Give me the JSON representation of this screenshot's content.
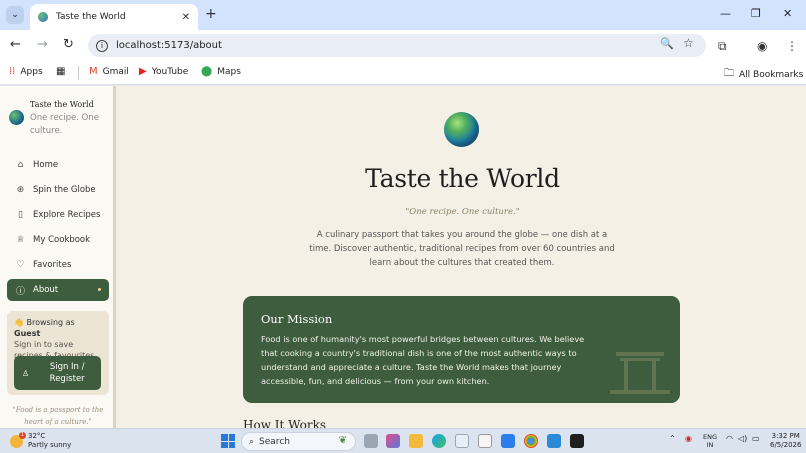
{
  "browser": {
    "tab_title": "Taste the World",
    "url": "localhost:5173/about",
    "bookmarks": [
      {
        "label": "Apps",
        "icon": "apps-grid-icon"
      },
      {
        "label": "Gmail",
        "icon": "gmail-icon"
      },
      {
        "label": "YouTube",
        "icon": "youtube-icon"
      },
      {
        "label": "Maps",
        "icon": "maps-icon"
      }
    ],
    "all_bookmarks": "All Bookmarks"
  },
  "sidebar": {
    "brand_title": "Taste the World",
    "brand_tagline": "One recipe. One culture.",
    "nav": [
      {
        "label": "Home",
        "icon": "home-icon",
        "active": false
      },
      {
        "label": "Spin the Globe",
        "icon": "globe-icon",
        "active": false
      },
      {
        "label": "Explore Recipes",
        "icon": "book-icon",
        "active": false
      },
      {
        "label": "My Cookbook",
        "icon": "chef-hat-icon",
        "active": false
      },
      {
        "label": "Favorites",
        "icon": "heart-icon",
        "active": false
      },
      {
        "label": "About",
        "icon": "info-icon",
        "active": true
      }
    ],
    "guest": {
      "prefix": "Browsing as",
      "name": "Guest",
      "sub": "Sign in to save recipes & favourites",
      "button": "Sign In / Register"
    },
    "quote": "\"Food is a passport to the heart of a culture.\""
  },
  "main": {
    "title": "Taste the World",
    "motto": "\"One recipe. One culture.\"",
    "description": "A culinary passport that takes you around the globe — one dish at a time. Discover authentic, traditional recipes from over 60 countries and learn about the cultures that created them.",
    "mission": {
      "title": "Our Mission",
      "text": "Food is one of humanity's most powerful bridges between cultures. We believe that cooking a country's traditional dish is one of the most authentic ways to understand and appreciate a culture. Taste the World makes that journey accessible, fun, and delicious — from your own kitchen."
    },
    "next_heading": "How It Works"
  },
  "taskbar": {
    "weather_temp": "32°C",
    "weather_desc": "Partly sunny",
    "weather_badge": "1",
    "search": "Search",
    "lang_top": "ENG",
    "lang_bottom": "IN",
    "time": "3:32 PM",
    "date": "6/5/2026"
  },
  "colors": {
    "accent_green": "#3e5c3e",
    "page_bg": "#f5f0e6",
    "sidebar_bg": "#fbf9f4"
  }
}
